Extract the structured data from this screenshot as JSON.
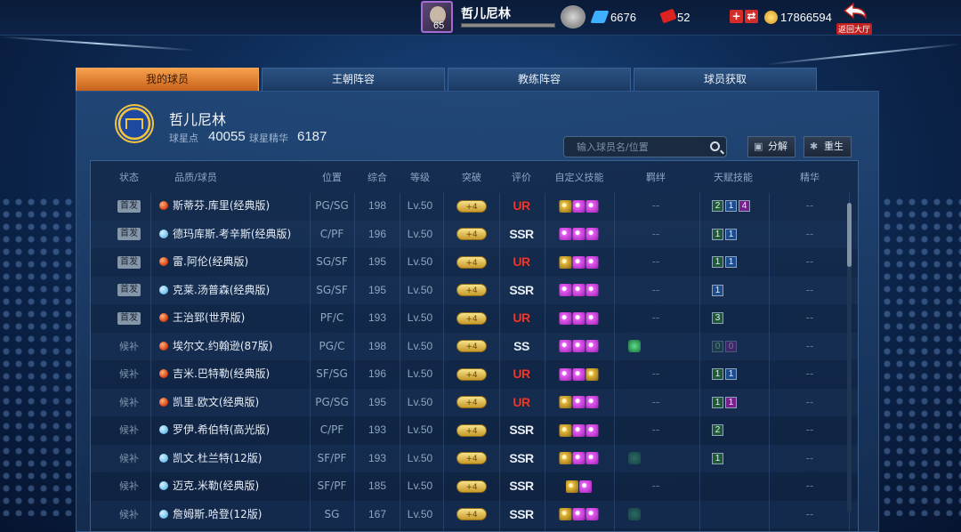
{
  "player": {
    "name": "哲儿尼林",
    "level": "65",
    "xp_fraction": 1.0
  },
  "resources": {
    "diamonds": "6676",
    "tickets": "52",
    "coins": "17866594"
  },
  "back_button_label": "返回大厅",
  "tabs": [
    {
      "label": "我的球员",
      "active": true
    },
    {
      "label": "王朝阵容",
      "active": false
    },
    {
      "label": "教练阵容",
      "active": false
    },
    {
      "label": "球员获取",
      "active": false
    }
  ],
  "team": {
    "name": "哲儿尼林",
    "star_points_label": "球星点",
    "star_points": "40055",
    "essence_label": "球星精华",
    "essence": "6187"
  },
  "search": {
    "placeholder": "输入球员名/位置"
  },
  "toolbar": {
    "decompose_label": "分解",
    "rebirth_label": "重生"
  },
  "columns": [
    "状态",
    "品质/球员",
    "位置",
    "综合",
    "等级",
    "突破",
    "评价",
    "自定义技能",
    "羁绊",
    "天赋技能",
    "精华"
  ],
  "break_badge_text": "+4",
  "players": [
    {
      "status": "首发",
      "starter": true,
      "dot": "red",
      "name": "斯蒂芬.库里(经典版)",
      "pos": "PG/SG",
      "ovr": "198",
      "lvl": "Lv.50",
      "grade": "UR",
      "skills": [
        "g",
        "p",
        "p"
      ],
      "bond": "--",
      "bond_icon": "",
      "talents": [
        {
          "v": "2",
          "c": "green"
        },
        {
          "v": "1",
          "c": "blue"
        },
        {
          "v": "4",
          "c": "purple"
        }
      ],
      "essence": "--"
    },
    {
      "status": "首发",
      "starter": true,
      "dot": "blue",
      "name": "德玛库斯.考辛斯(经典版)",
      "pos": "C/PF",
      "ovr": "196",
      "lvl": "Lv.50",
      "grade": "SSR",
      "skills": [
        "p",
        "p",
        "p"
      ],
      "bond": "--",
      "bond_icon": "",
      "talents": [
        {
          "v": "1",
          "c": "green"
        },
        {
          "v": "1",
          "c": "blue"
        }
      ],
      "essence": "--"
    },
    {
      "status": "首发",
      "starter": true,
      "dot": "red",
      "name": "雷.阿伦(经典版)",
      "pos": "SG/SF",
      "ovr": "195",
      "lvl": "Lv.50",
      "grade": "UR",
      "skills": [
        "g",
        "p",
        "p"
      ],
      "bond": "--",
      "bond_icon": "",
      "talents": [
        {
          "v": "1",
          "c": "green"
        },
        {
          "v": "1",
          "c": "blue"
        }
      ],
      "essence": "--"
    },
    {
      "status": "首发",
      "starter": true,
      "dot": "blue",
      "name": "克莱.汤普森(经典版)",
      "pos": "SG/SF",
      "ovr": "195",
      "lvl": "Lv.50",
      "grade": "SSR",
      "skills": [
        "p",
        "p",
        "p"
      ],
      "bond": "--",
      "bond_icon": "",
      "talents": [
        {
          "v": "1",
          "c": "blue"
        }
      ],
      "essence": "--"
    },
    {
      "status": "首发",
      "starter": true,
      "dot": "red",
      "name": "王治郅(世界版)",
      "pos": "PF/C",
      "ovr": "193",
      "lvl": "Lv.50",
      "grade": "UR",
      "skills": [
        "p",
        "p",
        "p"
      ],
      "bond": "--",
      "bond_icon": "",
      "talents": [
        {
          "v": "3",
          "c": "green"
        }
      ],
      "essence": "--"
    },
    {
      "status": "候补",
      "starter": false,
      "dot": "red",
      "name": "埃尔文.约翰逊(87版)",
      "pos": "PG/C",
      "ovr": "198",
      "lvl": "Lv.50",
      "grade": "SS",
      "skills": [
        "p",
        "p",
        "p"
      ],
      "bond": "",
      "bond_icon": "on",
      "talents": [
        {
          "v": "0",
          "c": "green dim"
        },
        {
          "v": "0",
          "c": "purple dim"
        }
      ],
      "essence": "--"
    },
    {
      "status": "候补",
      "starter": false,
      "dot": "red",
      "name": "吉米.巴特勒(经典版)",
      "pos": "SF/SG",
      "ovr": "196",
      "lvl": "Lv.50",
      "grade": "UR",
      "skills": [
        "p",
        "p",
        "g"
      ],
      "bond": "--",
      "bond_icon": "",
      "talents": [
        {
          "v": "1",
          "c": "green"
        },
        {
          "v": "1",
          "c": "blue"
        }
      ],
      "essence": "--"
    },
    {
      "status": "候补",
      "starter": false,
      "dot": "red",
      "name": "凯里.欧文(经典版)",
      "pos": "PG/SG",
      "ovr": "195",
      "lvl": "Lv.50",
      "grade": "UR",
      "skills": [
        "g",
        "p",
        "p"
      ],
      "bond": "--",
      "bond_icon": "",
      "talents": [
        {
          "v": "1",
          "c": "green"
        },
        {
          "v": "1",
          "c": "purple"
        }
      ],
      "essence": "--"
    },
    {
      "status": "候补",
      "starter": false,
      "dot": "blue",
      "name": "罗伊.希伯特(高光版)",
      "pos": "C/PF",
      "ovr": "193",
      "lvl": "Lv.50",
      "grade": "SSR",
      "skills": [
        "g",
        "p",
        "p"
      ],
      "bond": "--",
      "bond_icon": "",
      "talents": [
        {
          "v": "2",
          "c": "green"
        }
      ],
      "essence": "--"
    },
    {
      "status": "候补",
      "starter": false,
      "dot": "blue",
      "name": "凯文.杜兰特(12版)",
      "pos": "SF/PF",
      "ovr": "193",
      "lvl": "Lv.50",
      "grade": "SSR",
      "skills": [
        "g",
        "p",
        "p"
      ],
      "bond": "",
      "bond_icon": "dim",
      "talents": [
        {
          "v": "1",
          "c": "green"
        }
      ],
      "essence": "--"
    },
    {
      "status": "候补",
      "starter": false,
      "dot": "blue",
      "name": "迈克.米勒(经典版)",
      "pos": "SF/PF",
      "ovr": "185",
      "lvl": "Lv.50",
      "grade": "SSR",
      "skills": [
        "g",
        "p"
      ],
      "bond": "--",
      "bond_icon": "",
      "talents": [],
      "essence": "--"
    },
    {
      "status": "候补",
      "starter": false,
      "dot": "blue",
      "name": "詹姆斯.哈登(12版)",
      "pos": "SG",
      "ovr": "167",
      "lvl": "Lv.50",
      "grade": "SSR",
      "skills": [
        "g",
        "p",
        "p"
      ],
      "bond": "",
      "bond_icon": "dim",
      "talents": [],
      "essence": "--"
    }
  ]
}
